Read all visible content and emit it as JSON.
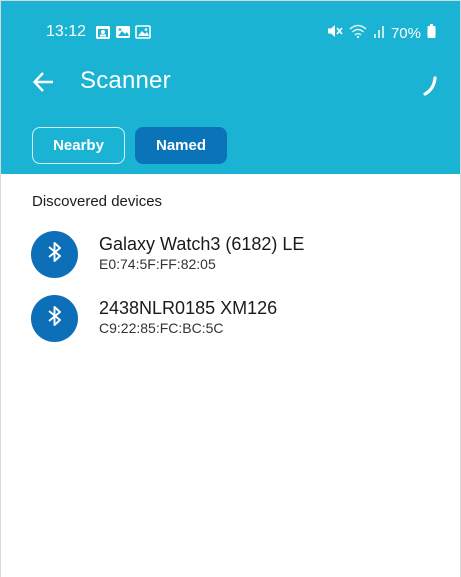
{
  "status_bar": {
    "time": "13:12",
    "battery": "70%",
    "left_icons": [
      "calendar-icon",
      "image-icon",
      "gallery-icon"
    ],
    "right_icons": [
      "mute-icon",
      "wifi-icon",
      "signal-icon",
      "battery-icon"
    ]
  },
  "toolbar": {
    "title": "Scanner"
  },
  "tabs": [
    {
      "label": "Nearby",
      "selected": false
    },
    {
      "label": "Named",
      "selected": true
    }
  ],
  "section": {
    "title": "Discovered devices"
  },
  "devices": [
    {
      "name": "Galaxy Watch3 (6182) LE",
      "mac": "E0:74:5F:FF:82:05",
      "icon": "bluetooth-icon"
    },
    {
      "name": "2438NLR0185 XM126",
      "mac": "C9:22:85:FC:BC:5C",
      "icon": "bluetooth-icon"
    }
  ],
  "colors": {
    "appbar": "#1ab3d3",
    "selected_tab": "#0b74b9",
    "device_avatar": "#0d6fb8"
  }
}
